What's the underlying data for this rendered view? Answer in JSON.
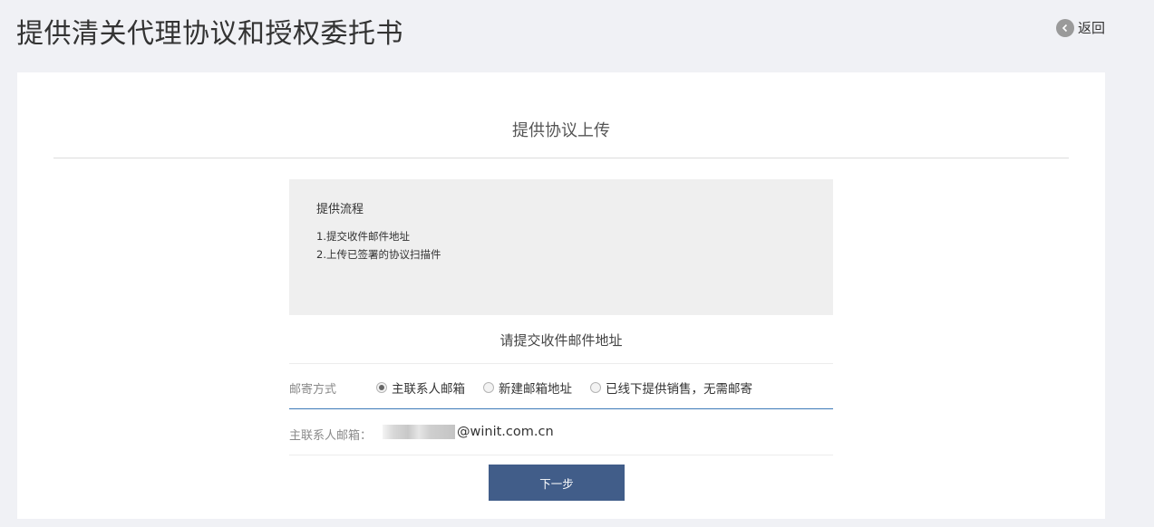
{
  "header": {
    "title": "提供清关代理协议和授权委托书",
    "back_label": "返回"
  },
  "card": {
    "heading": "提供协议上传",
    "process": {
      "title": "提供流程",
      "steps": [
        "1.提交收件邮件地址",
        "2.上传已签署的协议扫描件"
      ]
    },
    "section_heading": "请提交收件邮件地址",
    "mail_method": {
      "label": "邮寄方式",
      "options": [
        {
          "label": "主联系人邮箱",
          "selected": true
        },
        {
          "label": "新建邮箱地址",
          "selected": false
        },
        {
          "label": "已线下提供销售，无需邮寄",
          "selected": false
        }
      ]
    },
    "contact_email": {
      "label": "主联系人邮箱：",
      "value_suffix": "@winit.com.cn"
    },
    "next_button": "下一步"
  },
  "colors": {
    "background": "#f0f1f5",
    "button": "#415d89",
    "active_border": "#3d7ab8"
  }
}
